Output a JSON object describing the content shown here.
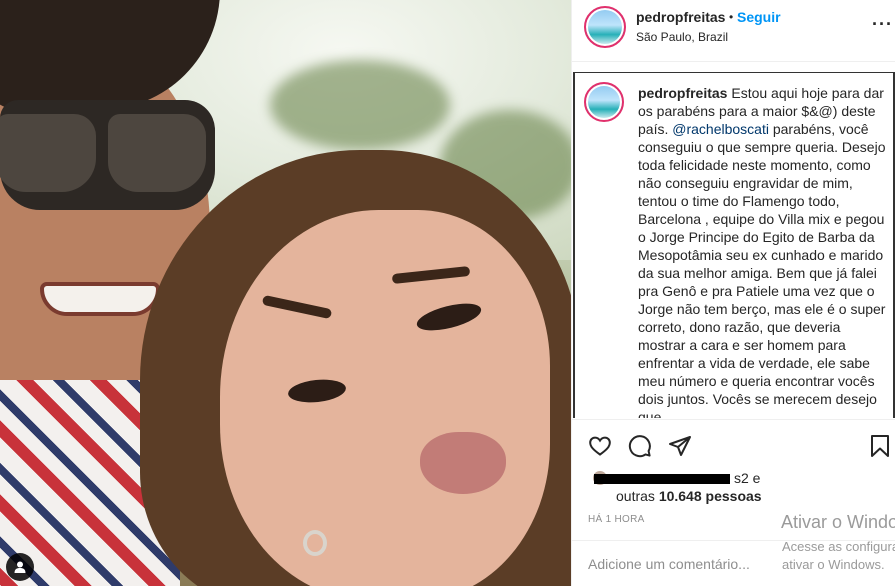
{
  "post": {
    "username": "pedropfreitas",
    "separator": "•",
    "follow_label": "Seguir",
    "location": "São Paulo, Brazil",
    "more_icon": "more-options-icon",
    "more_label": "···"
  },
  "caption": {
    "username": "pedropfreitas",
    "text_before_mention": "Estou aqui hoje para dar os parabéns para a maior $&@) deste país. ",
    "mention": "@rachelboscati",
    "text_after_mention": " parabéns, você conseguiu o que sempre queria. Desejo toda felicidade neste momento, como não conseguiu engravidar de mim, tentou o time do Flamengo todo, Barcelona , equipe do Villa mix e pegou o Jorge Principe do Egito de Barba da Mesopotâmia seu ex cunhado e marido da sua melhor amiga. Bem que já falei pra Genô e pra Patiele uma vez que o Jorge não tem berço, mas ele é o super correto, dono razão, que deveria mostrar a cara e ser homem para enfrentar a vida de verdade, ele sabe meu número e queria encontrar vocês dois juntos. Vocês se merecem desejo que"
  },
  "actions": {
    "like_icon": "heart-icon",
    "comment_icon": "comment-icon",
    "share_icon": "share-icon",
    "save_icon": "bookmark-icon"
  },
  "likes": {
    "line1_suffix": "s2 e",
    "line2_prefix": "outras",
    "count": "10.648",
    "line2_suffix": "pessoas"
  },
  "timestamp": "HÁ 1 HORA",
  "comment_input": {
    "placeholder": "Adicione um comentário..."
  },
  "photo": {
    "user_tag_icon": "user-tag-icon"
  },
  "watermark": {
    "title": "Ativar o Windows",
    "line1": "Acesse as configurações para",
    "line2": "ativar o Windows."
  },
  "colors": {
    "accent": "#0095f6",
    "text": "#262626",
    "muted": "#8e8e8e",
    "mention": "#00376b"
  }
}
